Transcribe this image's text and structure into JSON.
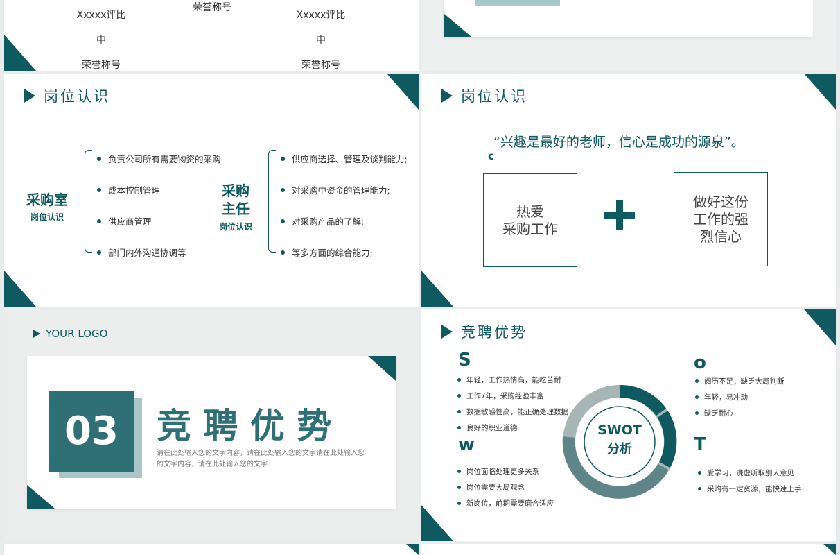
{
  "slide_top_left": {
    "col1": [
      "Xxxxx评比",
      "中",
      "荣誉称号"
    ],
    "col2": [
      "荣誉称号"
    ],
    "col3": [
      "Xxxxx评比",
      "中",
      "荣誉称号"
    ]
  },
  "slide_job_left": {
    "title": "岗位认识",
    "dept1": {
      "name": "采购室",
      "sub": "岗位认识"
    },
    "dept2": {
      "name_line1": "采购",
      "name_line2": "主任",
      "sub": "岗位认识"
    },
    "list1": [
      "负责公司所有需要物资的采购",
      "成本控制管理",
      "供应商管理",
      "部门内外沟通协调等"
    ],
    "list2": [
      "供应商选择、管理及谈判能力;",
      "对采购中资金的管理能力;",
      "对采购产品的了解;",
      "等多方面的综合能力;"
    ]
  },
  "slide_job_right": {
    "title": "岗位认识",
    "quote": "“兴趣是最好的老师，信心是成功的源泉”。",
    "small_letter": "c",
    "box_left": "热爱\n采购工作",
    "plus": "+",
    "box_right": "做好这份\n工作的强\n烈信心"
  },
  "slide_section": {
    "logo": "YOUR LOGO",
    "number": "03",
    "heading": "竞 聘 优 势",
    "desc": "请在此处输入您的文字内容，请在此处输入您的文字请在此处输入您的文字内容，请在此处输入您的文字"
  },
  "slide_swot": {
    "title": "竞聘优势",
    "center_line1": "SWOT",
    "center_line2": "分析",
    "S": {
      "letter": "S",
      "items": [
        "年轻，工作热情高，能吃苦耐",
        "工作7年，采购经验丰富",
        "数据敏感性高，能正确处理数据",
        "良好的职业道德"
      ]
    },
    "W": {
      "letter": "w",
      "items": [
        "岗位面临处理更多关系",
        "岗位需要大局观念",
        "新岗位，前期需要磨合适应"
      ]
    },
    "O": {
      "letter": "o",
      "items": [
        "阅历不足，缺乏大局判断",
        "年轻，易冲动",
        "缺乏耐心"
      ]
    },
    "T": {
      "letter": "T",
      "items": [
        "爱学习，谦虚听取别人意见",
        "采购有一定资源，能快速上手"
      ]
    },
    "ring_colors": [
      "#0e5a60",
      "#0e5a60",
      "#5f8589",
      "#a8b5b7"
    ]
  },
  "colors": {
    "accent": "#0e5a60",
    "light": "#a9c6c9"
  }
}
